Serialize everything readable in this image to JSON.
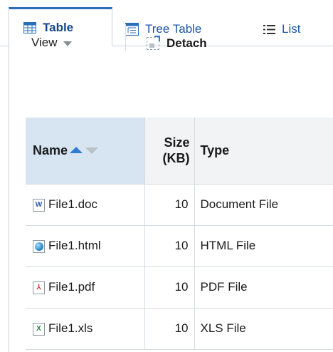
{
  "tabs": [
    {
      "label": "Table",
      "icon": "table-icon",
      "selected": true
    },
    {
      "label": "Tree Table",
      "icon": "tree-table-icon",
      "selected": false
    },
    {
      "label": "List",
      "icon": "list-icon",
      "selected": false
    }
  ],
  "toolbar": {
    "view_label": "View",
    "detach_label": "Detach"
  },
  "table": {
    "columns": {
      "name": "Name",
      "size_line1": "Size",
      "size_line2": "(KB)",
      "type": "Type"
    },
    "sort": {
      "column": "Name",
      "direction": "ascending"
    },
    "rows": [
      {
        "name": "File1.doc",
        "size": "10",
        "type": "Document File",
        "icon": "word-doc-icon"
      },
      {
        "name": "File1.html",
        "size": "10",
        "type": "HTML File",
        "icon": "html-globe-icon"
      },
      {
        "name": "File1.pdf",
        "size": "10",
        "type": "PDF File",
        "icon": "pdf-icon"
      },
      {
        "name": "File1.xls",
        "size": "10",
        "type": "XLS File",
        "icon": "excel-icon"
      }
    ]
  },
  "colors": {
    "accent": "#2a6ebb",
    "link": "#1a56a4",
    "sorted_header": "#d7e5f3"
  }
}
